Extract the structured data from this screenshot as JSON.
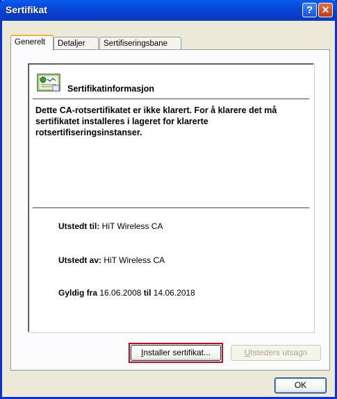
{
  "window": {
    "title": "Sertifikat",
    "help_label": "?",
    "close_label": "✕"
  },
  "tabs": [
    {
      "label": "Generelt",
      "active": true
    },
    {
      "label": "Detaljer",
      "active": false
    },
    {
      "label": "Sertifiseringsbane",
      "active": false
    }
  ],
  "general": {
    "heading": "Sertifikatinformasjon",
    "message": "Dette CA-rotsertifikatet er ikke klarert. For å klarere det må sertifikatet installeres i lageret for klarerte rotsertifiseringsinstanser.",
    "issued_to_label": "Utstedt til:",
    "issued_to_value": "HiT Wireless CA",
    "issued_by_label": "Utstedt av:",
    "issued_by_value": "HiT Wireless CA",
    "valid_from_label": "Gyldig fra",
    "valid_from_value": "16.06.2008",
    "valid_to_label": "til",
    "valid_to_value": "14.06.2018"
  },
  "buttons": {
    "install_mnemonic": "I",
    "install_rest": "nstaller sertifikat...",
    "statement_mnemonic": "U",
    "statement_rest": "tsteders utsagn",
    "ok": "OK"
  },
  "colors": {
    "highlight": "#e00000",
    "titlebar": "#0847d6"
  },
  "icons": {
    "certificate": "certificate-icon"
  }
}
